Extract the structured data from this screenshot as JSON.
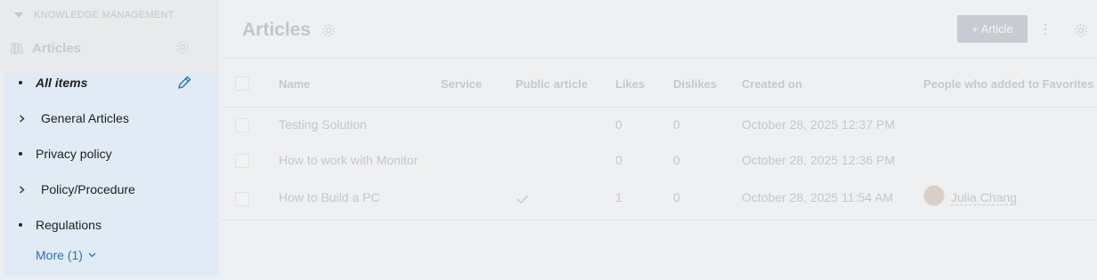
{
  "sidebar": {
    "section_label": "KNOWLEDGE MANAGEMENT",
    "title": "Articles",
    "items": [
      {
        "label": "All items",
        "type": "bullet",
        "active": true
      },
      {
        "label": "General Articles",
        "type": "expandable"
      },
      {
        "label": "Privacy policy",
        "type": "bullet"
      },
      {
        "label": "Policy/Procedure",
        "type": "expandable"
      },
      {
        "label": "Regulations",
        "type": "bullet"
      }
    ],
    "more_label": "More (1)"
  },
  "main": {
    "title": "Articles",
    "add_button_label": "+ Article",
    "columns": [
      "Name",
      "Service",
      "Public article",
      "Likes",
      "Dislikes",
      "Created on",
      "People who added to Favorites"
    ],
    "rows": [
      {
        "name": "Testing Solution",
        "service": "",
        "public": false,
        "likes": "0",
        "dislikes": "0",
        "created": "October 28, 2025 12:37 PM",
        "favorites": ""
      },
      {
        "name": "How to work with Monitor",
        "service": "",
        "public": false,
        "likes": "0",
        "dislikes": "0",
        "created": "October 28, 2025 12:36 PM",
        "favorites": ""
      },
      {
        "name": "How to Build a PC",
        "service": "",
        "public": true,
        "likes": "1",
        "dislikes": "0",
        "created": "October 28, 2025 11:54 AM",
        "favorites": "Julia Chang"
      }
    ]
  },
  "colors": {
    "sidebar_list_bg": "#e1ebf6",
    "link_blue": "#2d6fb3",
    "button_bg": "#c7ccd3"
  },
  "icons": [
    "caret-down-icon",
    "book-icon",
    "gear-icon",
    "pencil-icon",
    "chevron-right-icon",
    "chevron-down-icon",
    "kebab-icon",
    "check-icon",
    "avatar"
  ]
}
